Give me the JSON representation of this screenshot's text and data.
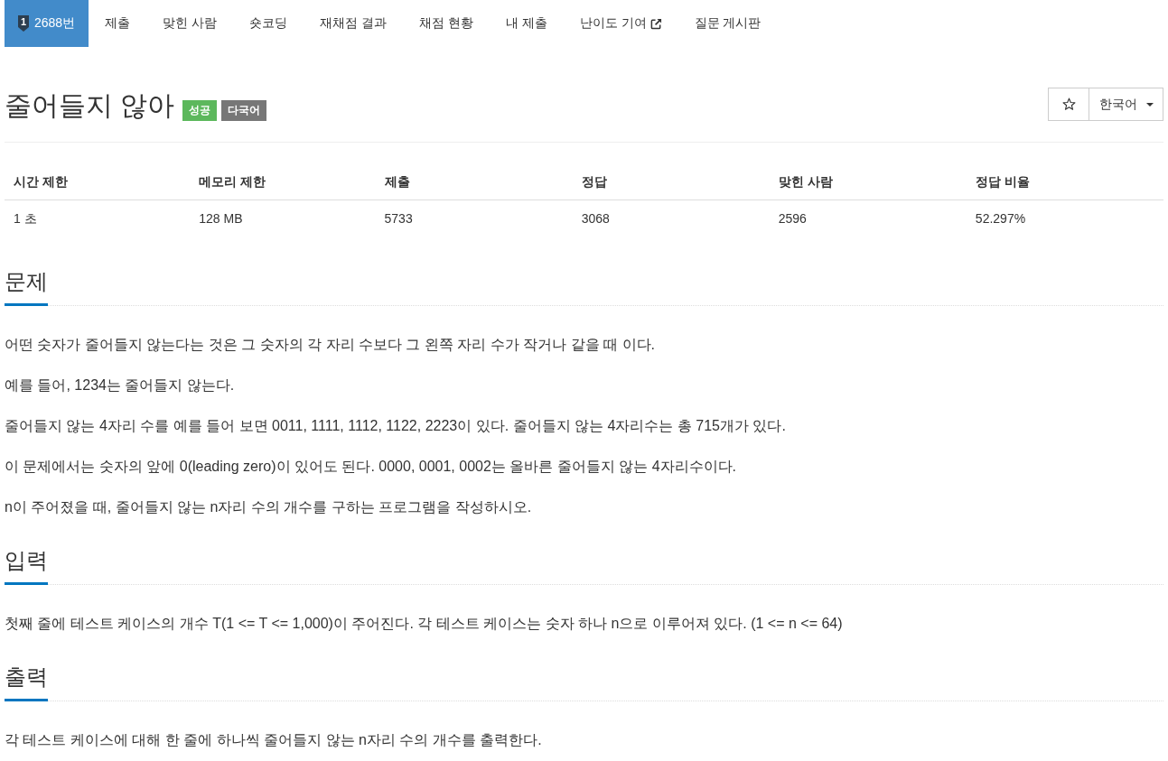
{
  "nav": {
    "items": [
      {
        "label": "2688번",
        "selected": true,
        "tier": "1"
      },
      {
        "label": "제출",
        "selected": false
      },
      {
        "label": "맞힌 사람",
        "selected": false
      },
      {
        "label": "숏코딩",
        "selected": false
      },
      {
        "label": "재채점 결과",
        "selected": false
      },
      {
        "label": "채점 현황",
        "selected": false
      },
      {
        "label": "내 제출",
        "selected": false
      },
      {
        "label": "난이도 기여",
        "selected": false,
        "external": true
      },
      {
        "label": "질문 게시판",
        "selected": false
      }
    ]
  },
  "problem": {
    "title": "줄어들지 않아",
    "labels": [
      {
        "text": "성공",
        "color": "#5cb85c"
      },
      {
        "text": "다국어",
        "color": "#777777"
      }
    ],
    "starred": false,
    "language": "한국어"
  },
  "stats": {
    "columns": [
      "시간 제한",
      "메모리 제한",
      "제출",
      "정답",
      "맞힌 사람",
      "정답 비율"
    ],
    "rows": [
      [
        "1 초",
        "128 MB",
        "5733",
        "3068",
        "2596",
        "52.297%"
      ]
    ]
  },
  "sections": [
    {
      "heading": "문제",
      "paragraphs": [
        "어떤 숫자가 줄어들지 않는다는 것은 그 숫자의 각 자리 수보다 그 왼쪽 자리 수가 작거나 같을 때 이다.",
        "예를 들어, 1234는 줄어들지 않는다.",
        "줄어들지 않는 4자리 수를 예를 들어 보면 0011, 1111, 1112, 1122, 2223이 있다. 줄어들지 않는 4자리수는 총 715개가 있다.",
        "이 문제에서는 숫자의 앞에 0(leading zero)이 있어도 된다. 0000, 0001, 0002는 올바른 줄어들지 않는 4자리수이다.",
        "n이 주어졌을 때, 줄어들지 않는 n자리 수의 개수를 구하는 프로그램을 작성하시오."
      ]
    },
    {
      "heading": "입력",
      "paragraphs": [
        "첫째 줄에 테스트 케이스의 개수 T(1 <= T <= 1,000)이 주어진다. 각 테스트 케이스는 숫자 하나 n으로 이루어져 있다. (1 <= n <= 64)"
      ]
    },
    {
      "heading": "출력",
      "paragraphs": [
        "각 테스트 케이스에 대해 한 줄에 하나씩 줄어들지 않는 n자리 수의 개수를 출력한다."
      ]
    }
  ]
}
